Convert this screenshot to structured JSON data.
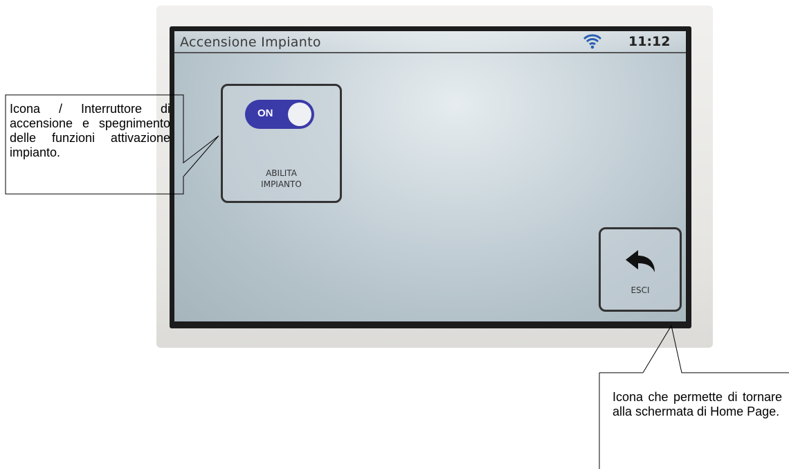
{
  "screen": {
    "title": "Accensione Impianto",
    "clock": "11:12",
    "status_icons": [
      "wifi-icon"
    ]
  },
  "tiles": {
    "impianto": {
      "toggle_state": "ON",
      "caption_line1": "ABILITA",
      "caption_line2": "IMPIANTO"
    },
    "esci": {
      "icon": "back-arrow-icon",
      "caption": "ESCI"
    }
  },
  "callouts": {
    "left": "Icona / Interruttore di accensione e spegnimento delle funzioni attivazione impianto.",
    "right": "Icona che permette di tornare alla schermata di Home Page."
  },
  "colors": {
    "toggle_on": "#3a3aa8",
    "wifi": "#2a5fb0"
  }
}
